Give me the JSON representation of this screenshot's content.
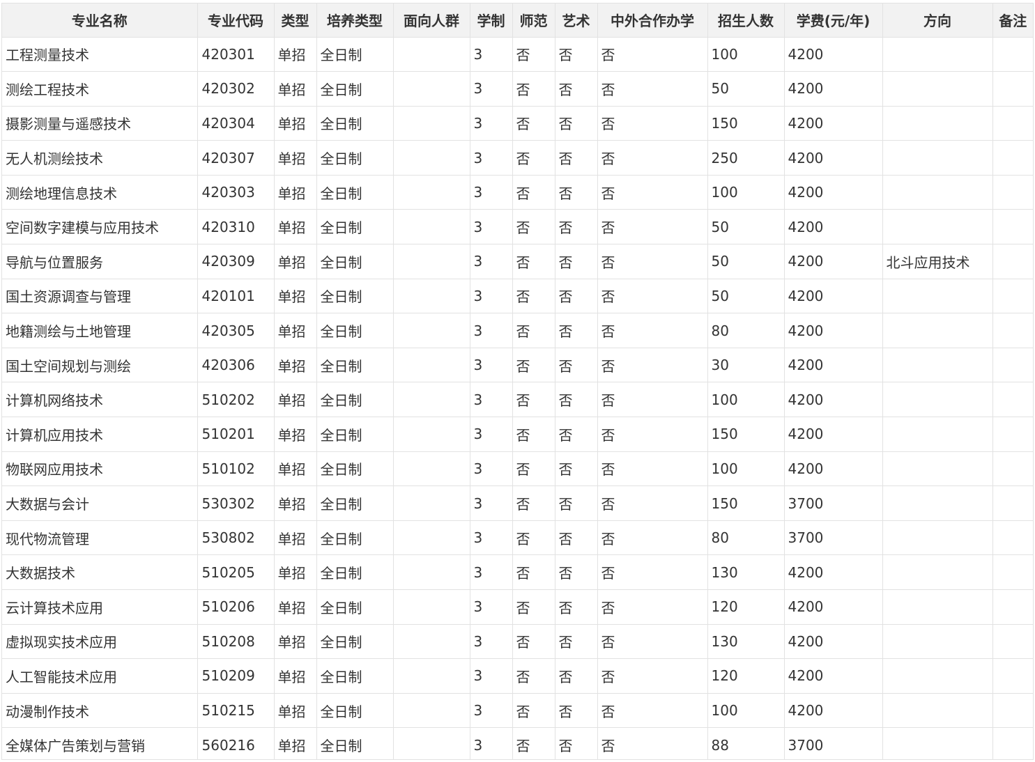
{
  "table": {
    "headers": [
      "专业名称",
      "专业代码",
      "类型",
      "培养类型",
      "面向人群",
      "学制",
      "师范",
      "艺术",
      "中外合作办学",
      "招生人数",
      "学费(元/年)",
      "方向",
      "备注"
    ],
    "rows": [
      [
        "工程测量技术",
        "420301",
        "单招",
        "全日制",
        "",
        "3",
        "否",
        "否",
        "否",
        "100",
        "4200",
        "",
        ""
      ],
      [
        "测绘工程技术",
        "420302",
        "单招",
        "全日制",
        "",
        "3",
        "否",
        "否",
        "否",
        "50",
        "4200",
        "",
        ""
      ],
      [
        "摄影测量与遥感技术",
        "420304",
        "单招",
        "全日制",
        "",
        "3",
        "否",
        "否",
        "否",
        "150",
        "4200",
        "",
        ""
      ],
      [
        "无人机测绘技术",
        "420307",
        "单招",
        "全日制",
        "",
        "3",
        "否",
        "否",
        "否",
        "250",
        "4200",
        "",
        ""
      ],
      [
        "测绘地理信息技术",
        "420303",
        "单招",
        "全日制",
        "",
        "3",
        "否",
        "否",
        "否",
        "100",
        "4200",
        "",
        ""
      ],
      [
        "空间数字建模与应用技术",
        "420310",
        "单招",
        "全日制",
        "",
        "3",
        "否",
        "否",
        "否",
        "50",
        "4200",
        "",
        ""
      ],
      [
        "导航与位置服务",
        "420309",
        "单招",
        "全日制",
        "",
        "3",
        "否",
        "否",
        "否",
        "50",
        "4200",
        "北斗应用技术",
        ""
      ],
      [
        "国土资源调查与管理",
        "420101",
        "单招",
        "全日制",
        "",
        "3",
        "否",
        "否",
        "否",
        "50",
        "4200",
        "",
        ""
      ],
      [
        "地籍测绘与土地管理",
        "420305",
        "单招",
        "全日制",
        "",
        "3",
        "否",
        "否",
        "否",
        "80",
        "4200",
        "",
        ""
      ],
      [
        "国土空间规划与测绘",
        "420306",
        "单招",
        "全日制",
        "",
        "3",
        "否",
        "否",
        "否",
        "30",
        "4200",
        "",
        ""
      ],
      [
        "计算机网络技术",
        "510202",
        "单招",
        "全日制",
        "",
        "3",
        "否",
        "否",
        "否",
        "100",
        "4200",
        "",
        ""
      ],
      [
        "计算机应用技术",
        "510201",
        "单招",
        "全日制",
        "",
        "3",
        "否",
        "否",
        "否",
        "150",
        "4200",
        "",
        ""
      ],
      [
        "物联网应用技术",
        "510102",
        "单招",
        "全日制",
        "",
        "3",
        "否",
        "否",
        "否",
        "100",
        "4200",
        "",
        ""
      ],
      [
        "大数据与会计",
        "530302",
        "单招",
        "全日制",
        "",
        "3",
        "否",
        "否",
        "否",
        "150",
        "3700",
        "",
        ""
      ],
      [
        "现代物流管理",
        "530802",
        "单招",
        "全日制",
        "",
        "3",
        "否",
        "否",
        "否",
        "80",
        "3700",
        "",
        ""
      ],
      [
        "大数据技术",
        "510205",
        "单招",
        "全日制",
        "",
        "3",
        "否",
        "否",
        "否",
        "130",
        "4200",
        "",
        ""
      ],
      [
        "云计算技术应用",
        "510206",
        "单招",
        "全日制",
        "",
        "3",
        "否",
        "否",
        "否",
        "120",
        "4200",
        "",
        ""
      ],
      [
        "虚拟现实技术应用",
        "510208",
        "单招",
        "全日制",
        "",
        "3",
        "否",
        "否",
        "否",
        "130",
        "4200",
        "",
        ""
      ],
      [
        "人工智能技术应用",
        "510209",
        "单招",
        "全日制",
        "",
        "3",
        "否",
        "否",
        "否",
        "120",
        "4200",
        "",
        ""
      ],
      [
        "动漫制作技术",
        "510215",
        "单招",
        "全日制",
        "",
        "3",
        "否",
        "否",
        "否",
        "100",
        "4200",
        "",
        ""
      ],
      [
        "全媒体广告策划与营销",
        "560216",
        "单招",
        "全日制",
        "",
        "3",
        "否",
        "否",
        "否",
        "88",
        "3700",
        "",
        ""
      ]
    ]
  }
}
